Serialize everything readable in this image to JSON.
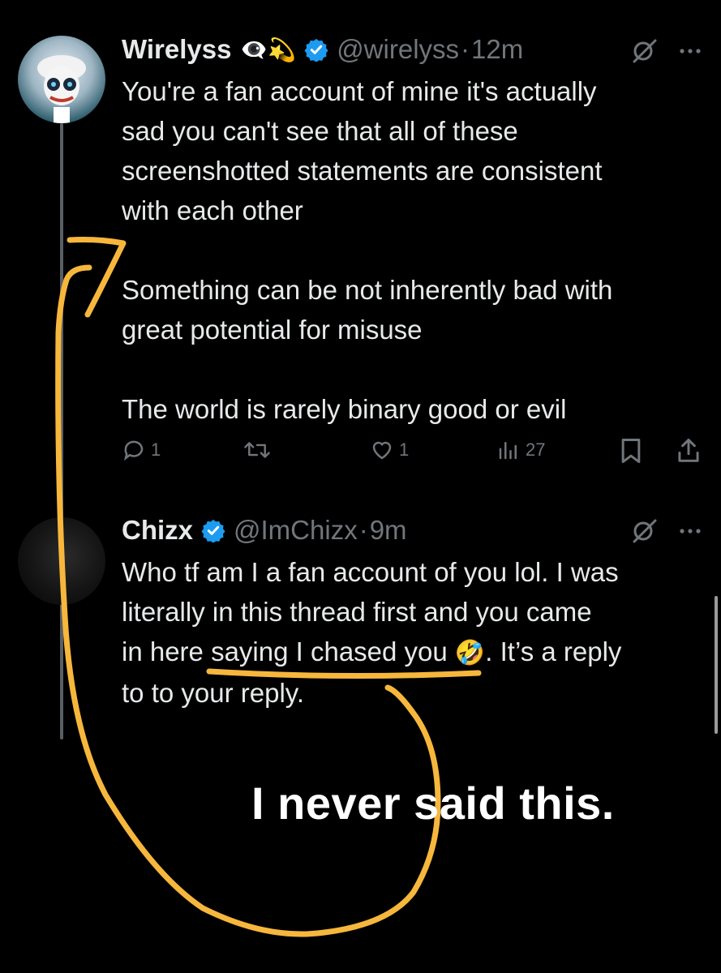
{
  "tweet1": {
    "name": "Wirelyss",
    "emojis": "👁️‍🗨️💫",
    "handle": "@wirelyss",
    "dot": "·",
    "time": "12m",
    "text": "You're a fan account of mine it's actually\nsad you can't see that all of these\nscreenshotted statements are consistent\nwith each other\n\nSomething can be not inherently bad with\ngreat potential for misuse\n\nThe world is rarely binary good or evil",
    "replies": "1",
    "likes": "1",
    "views": "27"
  },
  "tweet2": {
    "name": "Chizx",
    "handle": "@ImChizx",
    "dot": "·",
    "time": "9m",
    "text_line1": "Who tf am I a fan account of you lol. I was",
    "text_line2": "literally in this thread first and you came",
    "text_line3_pre": "in here saying I chased you ",
    "text_line3_emoji": "🤣",
    "text_line3_post": ". It’s a reply",
    "text_line4": "to to your reply."
  },
  "annotation": {
    "text": "I never said this.",
    "color": "#f6b73c"
  },
  "colors": {
    "verified": "#1d9bf0",
    "muted": "#71767b",
    "text": "#e7e9ea"
  }
}
